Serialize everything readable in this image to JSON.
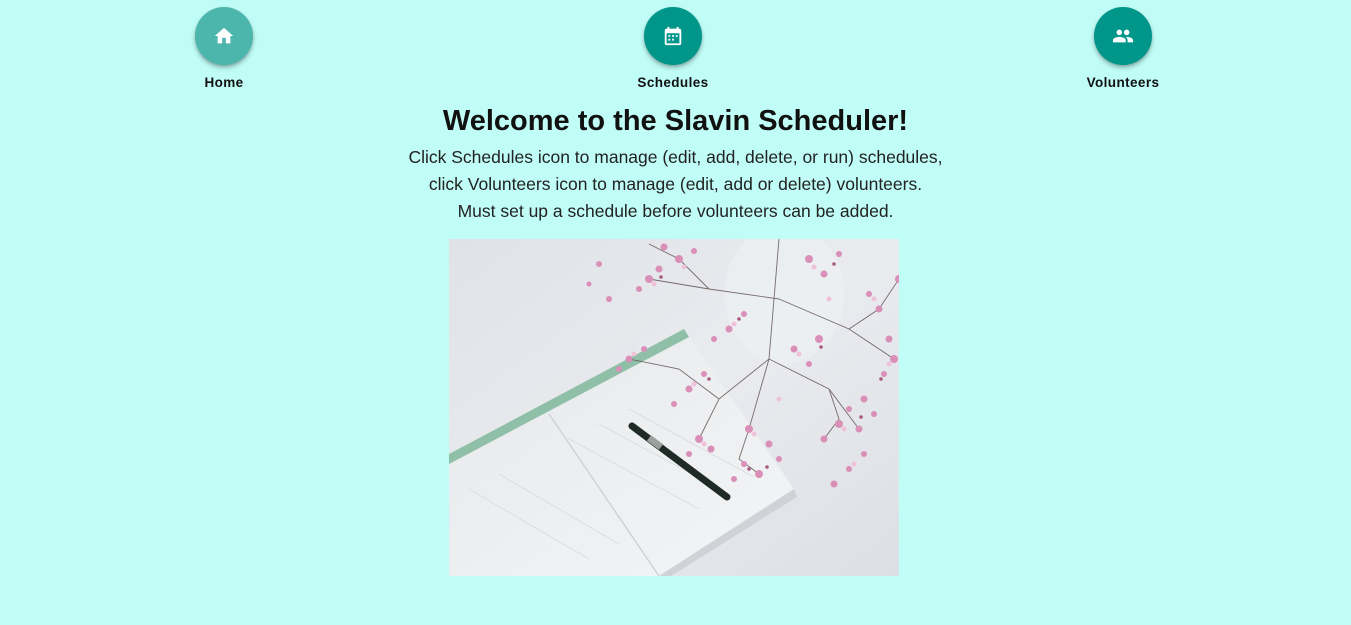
{
  "nav": {
    "items": [
      {
        "label": "Home",
        "icon": "home-icon",
        "color": "#4db6ac"
      },
      {
        "label": "Schedules",
        "icon": "calendar-icon",
        "color": "#00968a"
      },
      {
        "label": "Volunteers",
        "icon": "people-icon",
        "color": "#00968a"
      }
    ]
  },
  "main": {
    "title": "Welcome to the Slavin Scheduler!",
    "lines": [
      "Click Schedules icon to manage (edit, add, delete, or run) schedules,",
      "click Volunteers icon to manage (edit, add or delete) volunteers.",
      "Must set up a schedule before volunteers can be added."
    ]
  },
  "colors": {
    "background": "#c0fdf7",
    "accent": "#00968a",
    "accent_light": "#4db6ac"
  }
}
